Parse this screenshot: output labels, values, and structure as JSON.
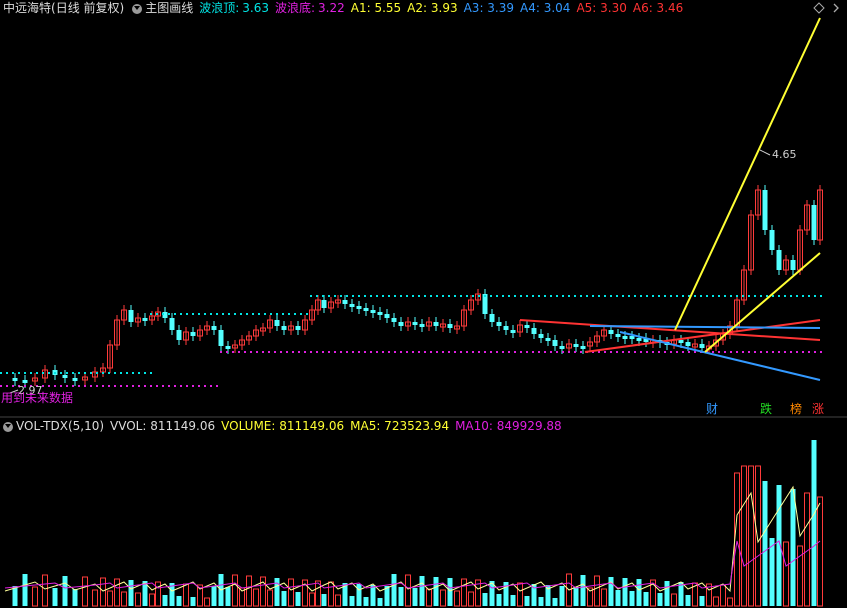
{
  "header": {
    "title": "中远海特",
    "period": "(日线 前复权)",
    "indicator_name": "主图画线",
    "wave_top_label": "波浪顶:",
    "wave_top_value": "3.63",
    "wave_bottom_label": "波浪底:",
    "wave_bottom_value": "3.22",
    "a1": "A1: 5.55",
    "a2": "A2: 3.93",
    "a3": "A3: 3.39",
    "a4": "A4: 3.04",
    "a5": "A5: 3.30",
    "a6": "A6: 3.46",
    "colors": {
      "title": "#dcdcdc",
      "wave_top": "#00e5e5",
      "wave_bottom": "#e020e0",
      "a1": "#ffff33",
      "a2": "#ffff33",
      "a3": "#3399ff",
      "a4": "#3399ff",
      "a5": "#ff3333",
      "a6": "#ff3333"
    }
  },
  "chart": {
    "high_label": "4.65",
    "low_label": "2.97",
    "note": "用到未来数据",
    "flags": [
      "财",
      "跌",
      "榜",
      "涨"
    ],
    "flag_colors": [
      "#3399ff",
      "#22dd22",
      "#ff8800",
      "#ff3333"
    ]
  },
  "volume": {
    "name": "VOL-TDX(5,10)",
    "vvol": "VVOL: 811149.06",
    "volume": "VOLUME: 811149.06",
    "ma5": "MA5: 723523.94",
    "ma10": "MA10: 849929.88",
    "colors": {
      "name": "#dcdcdc",
      "vvol": "#dcdcdc",
      "volume": "#ffff33",
      "ma5": "#ffff33",
      "ma10": "#e020e0"
    }
  },
  "icons": {
    "top_circle": "dropdown-circle-icon",
    "vol_circle": "dropdown-circle-icon",
    "diamond": "diamond-icon",
    "chevron": "chevron-right-icon"
  }
}
